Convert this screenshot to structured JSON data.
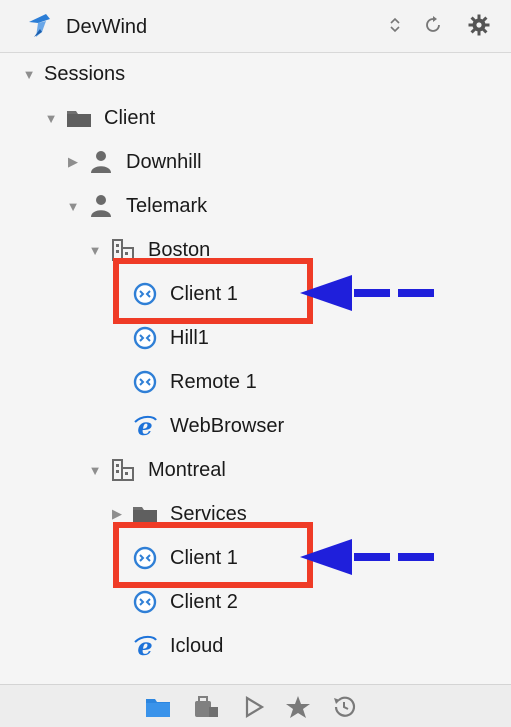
{
  "app": {
    "title": "DevWind"
  },
  "header": {
    "sort_icon": "sort-updown-icon",
    "refresh_icon": "refresh-icon",
    "settings_icon": "gear-icon"
  },
  "tree": {
    "root": "Sessions",
    "client": "Client",
    "downhill": "Downhill",
    "telemark": "Telemark",
    "boston": "Boston",
    "boston_items": [
      "Client 1",
      "Hill1",
      "Remote 1",
      "WebBrowser"
    ],
    "montreal": "Montreal",
    "services": "Services",
    "montreal_items": [
      "Client 1",
      "Client 2",
      "Icloud"
    ]
  },
  "colors": {
    "highlight": "#ef3b26",
    "arrow": "#1f1fdb",
    "rdp": "#2f7fd6",
    "ie": "#1e73d9"
  },
  "footer": {
    "icons": [
      "sessions-icon",
      "briefcase-icon",
      "play-icon",
      "favorites-star-icon",
      "history-icon"
    ]
  }
}
